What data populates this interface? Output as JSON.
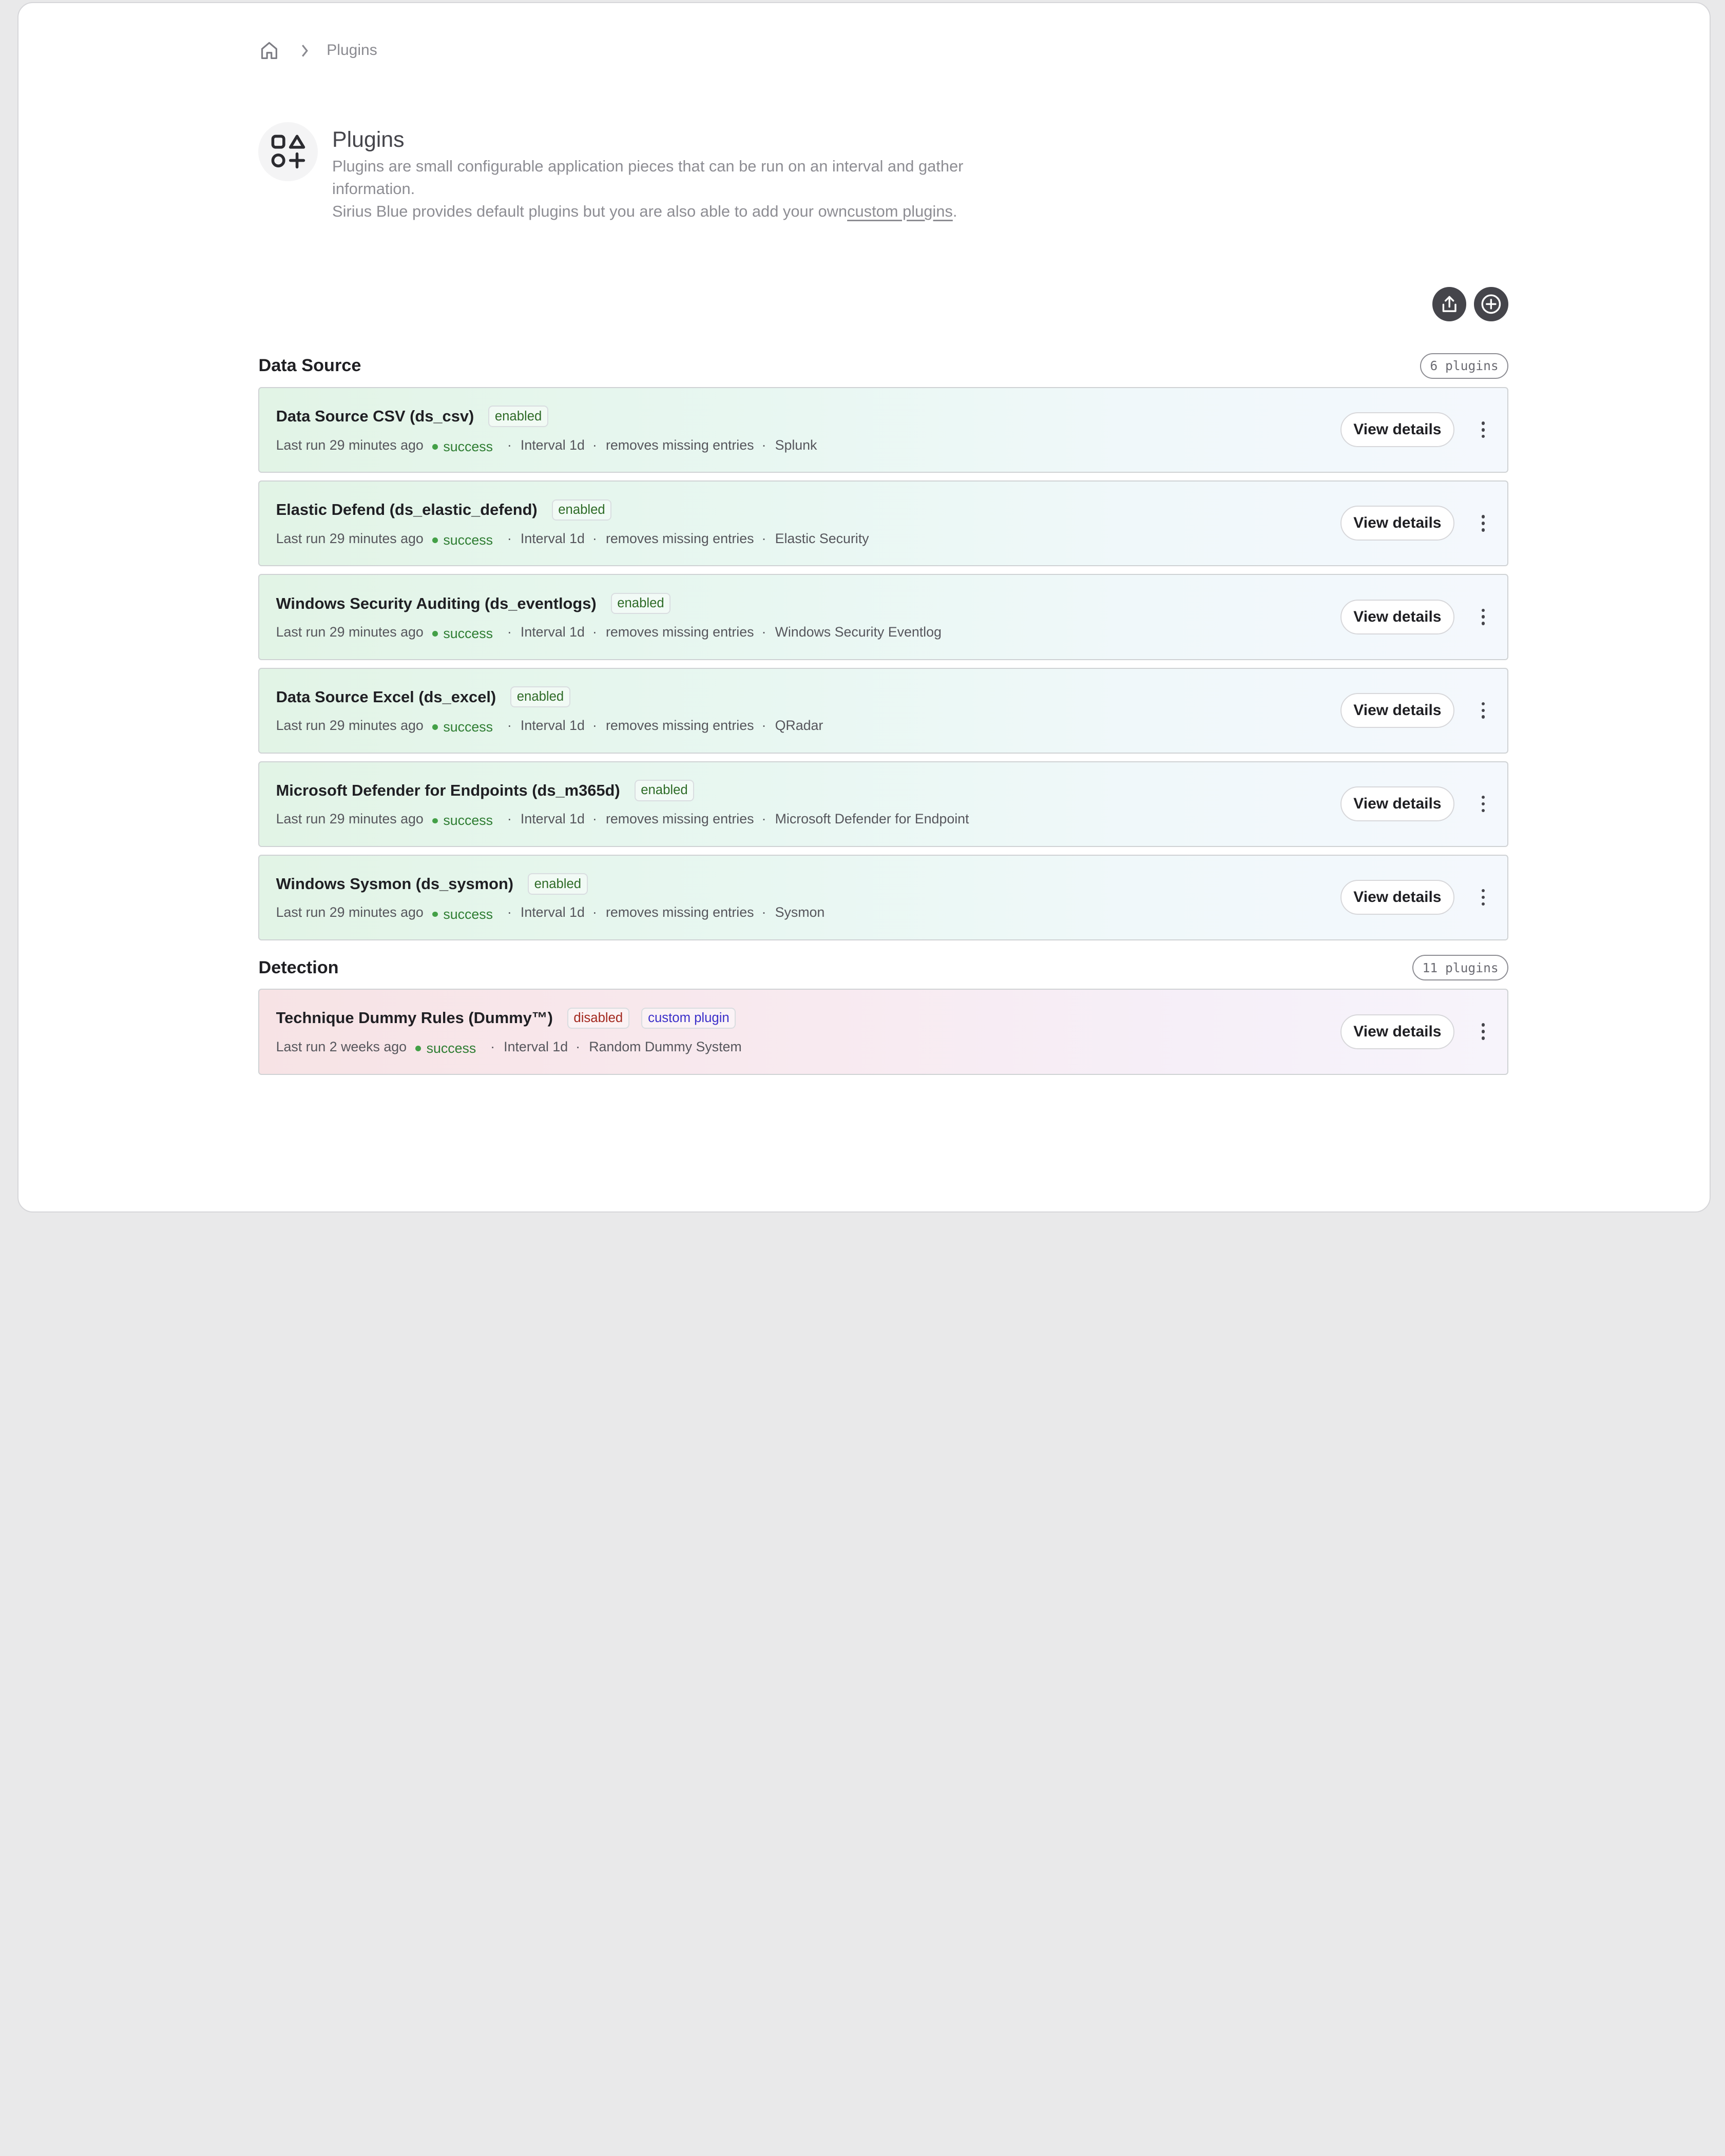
{
  "breadcrumb": {
    "home_icon": "home-icon",
    "current": "Plugins"
  },
  "hero": {
    "icon": "shapes-icon",
    "title": "Plugins",
    "desc_line1": "Plugins are small configurable application pieces that can be run on an interval and gather information.",
    "desc_line2_prefix": "Sirius Blue provides default plugins but you are also able to add your own",
    "desc_link": "custom plugins",
    "desc_line2_suffix": "."
  },
  "actions": {
    "upload_icon": "upload-icon",
    "add_icon": "add-circle-icon"
  },
  "sections": [
    {
      "title": "Data Source",
      "count": "6 plugins",
      "plugins": [
        {
          "name": "Data Source CSV (ds_csv)",
          "state": "enabled",
          "last_run": "Last run 29 minutes ago",
          "status": "success",
          "interval": "Interval 1d",
          "removes": "removes missing entries",
          "system": "Splunk",
          "button": "View details"
        },
        {
          "name": "Elastic Defend (ds_elastic_defend)",
          "state": "enabled",
          "last_run": "Last run 29 minutes ago",
          "status": "success",
          "interval": "Interval 1d",
          "removes": "removes missing entries",
          "system": "Elastic Security",
          "button": "View details"
        },
        {
          "name": "Windows Security Auditing (ds_eventlogs)",
          "state": "enabled",
          "last_run": "Last run 29 minutes ago",
          "status": "success",
          "interval": "Interval 1d",
          "removes": "removes missing entries",
          "system": "Windows Security Eventlog",
          "button": "View details"
        },
        {
          "name": "Data Source Excel (ds_excel)",
          "state": "enabled",
          "last_run": "Last run 29 minutes ago",
          "status": "success",
          "interval": "Interval 1d",
          "removes": "removes missing entries",
          "system": "QRadar",
          "button": "View details"
        },
        {
          "name": "Microsoft Defender for Endpoints (ds_m365d)",
          "state": "enabled",
          "last_run": "Last run 29 minutes ago",
          "status": "success",
          "interval": "Interval 1d",
          "removes": "removes missing entries",
          "system": "Microsoft Defender for Endpoint",
          "button": "View details"
        },
        {
          "name": "Windows Sysmon (ds_sysmon)",
          "state": "enabled",
          "last_run": "Last run 29 minutes ago",
          "status": "success",
          "interval": "Interval 1d",
          "removes": "removes missing entries",
          "system": "Sysmon",
          "button": "View details"
        }
      ]
    },
    {
      "title": "Detection",
      "count": "11 plugins",
      "plugins": [
        {
          "name": "Technique Dummy Rules (Dummy™)",
          "state": "disabled",
          "tag": "custom plugin",
          "last_run": "Last run 2 weeks ago",
          "status": "success",
          "interval": "Interval 1d",
          "system": "Random Dummy System",
          "button": "View details"
        }
      ]
    }
  ]
}
